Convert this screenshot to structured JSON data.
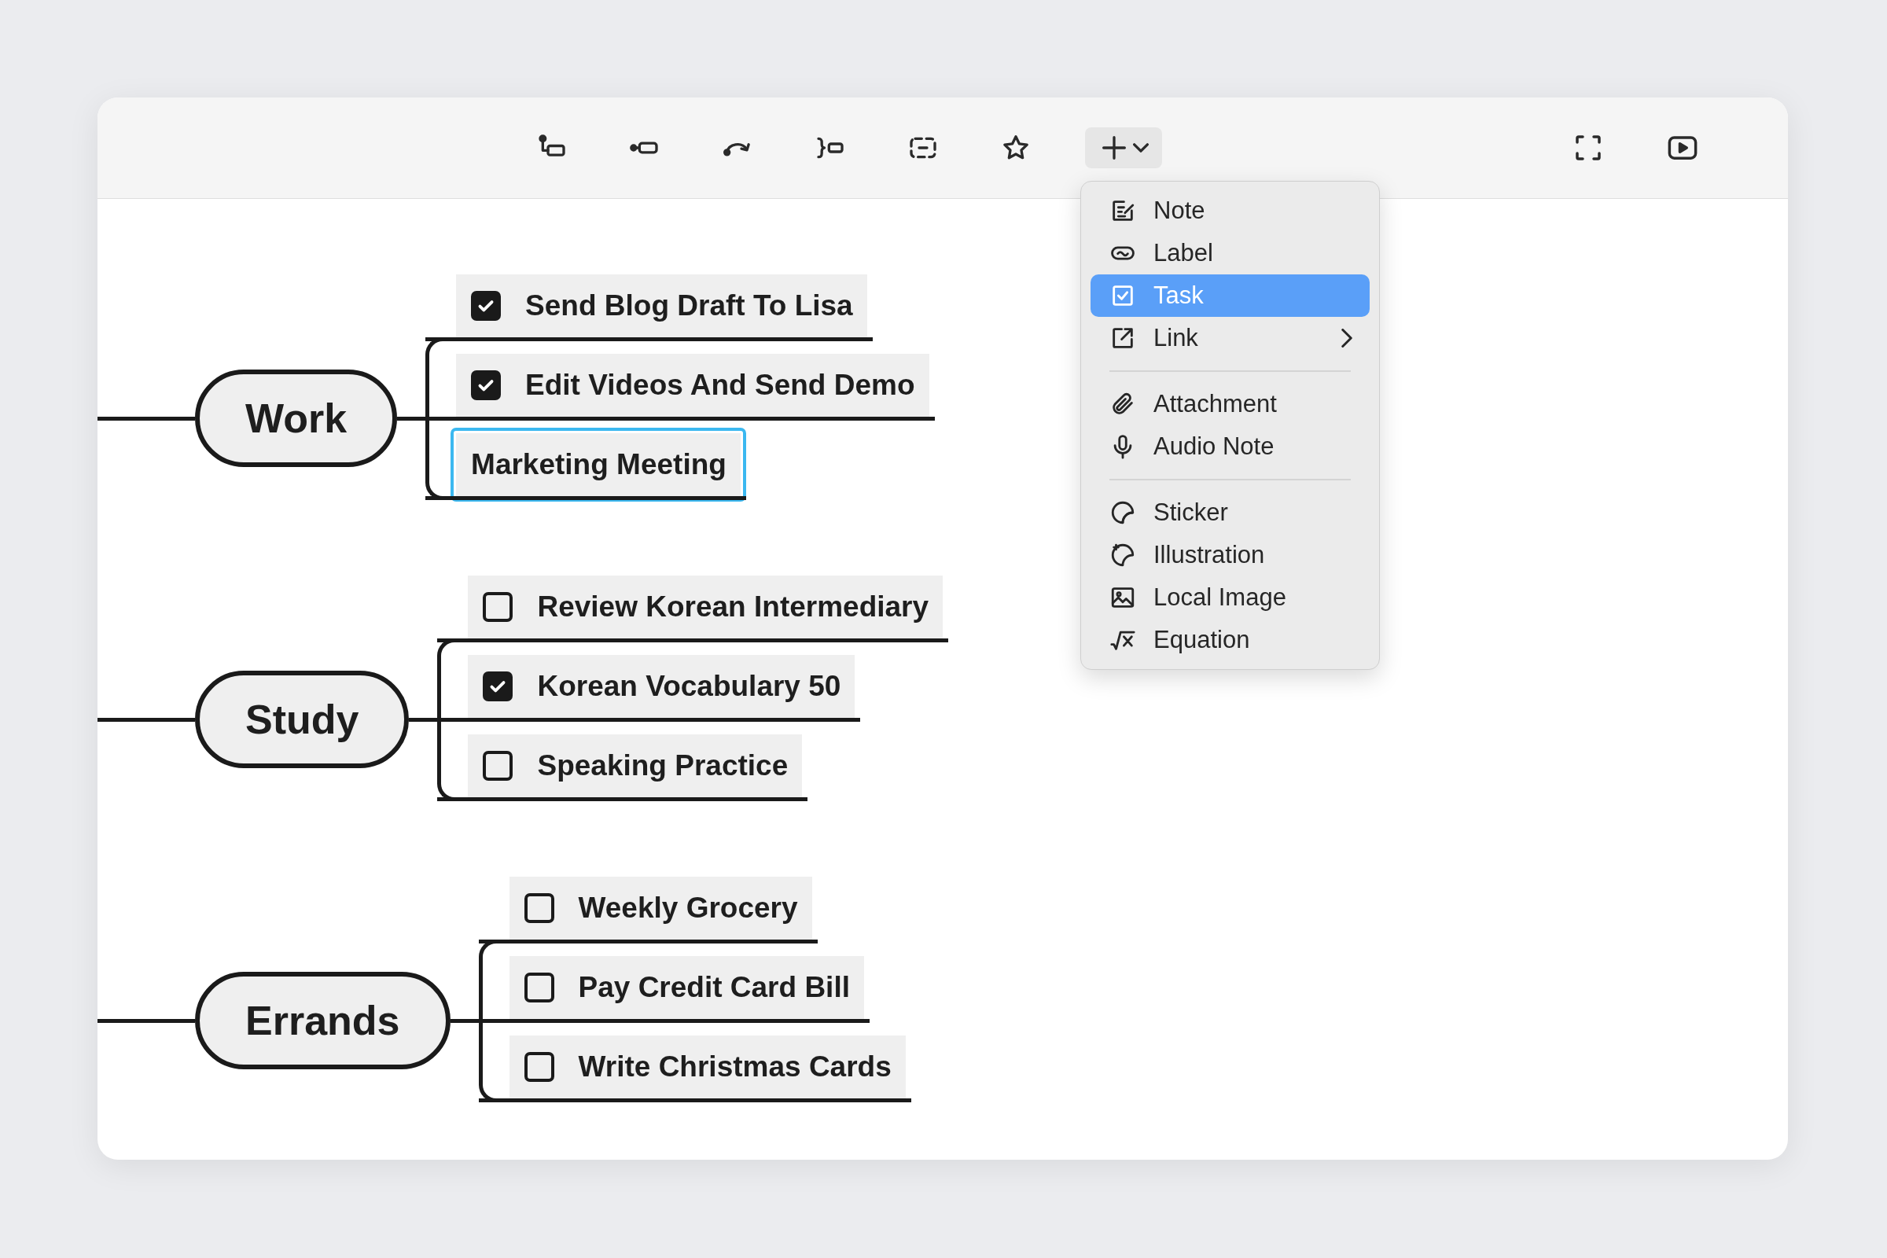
{
  "toolbar": {
    "insert_menu_open": true
  },
  "insert_menu": {
    "sections": [
      [
        {
          "label": "Note",
          "selected": false,
          "submenu": false
        },
        {
          "label": "Label",
          "selected": false,
          "submenu": false
        },
        {
          "label": "Task",
          "selected": true,
          "submenu": false
        },
        {
          "label": "Link",
          "selected": false,
          "submenu": true
        }
      ],
      [
        {
          "label": "Attachment",
          "selected": false,
          "submenu": false
        },
        {
          "label": "Audio Note",
          "selected": false,
          "submenu": false
        }
      ],
      [
        {
          "label": "Sticker",
          "selected": false,
          "submenu": false
        },
        {
          "label": "Illustration",
          "selected": false,
          "submenu": false
        },
        {
          "label": "Local Image",
          "selected": false,
          "submenu": false
        },
        {
          "label": "Equation",
          "selected": false,
          "submenu": false
        }
      ]
    ]
  },
  "mind_map": {
    "topics": [
      {
        "label": "Work",
        "children": [
          {
            "kind": "task",
            "label": "Send Blog Draft To Lisa",
            "checked": true,
            "selected": false
          },
          {
            "kind": "task",
            "label": "Edit Videos And Send Demo",
            "checked": true,
            "selected": false
          },
          {
            "kind": "topic",
            "label": "Marketing Meeting",
            "selected": true
          }
        ]
      },
      {
        "label": "Study",
        "children": [
          {
            "kind": "task",
            "label": "Review Korean Intermediary",
            "checked": false,
            "selected": false
          },
          {
            "kind": "task",
            "label": "Korean Vocabulary 50",
            "checked": true,
            "selected": false
          },
          {
            "kind": "task",
            "label": "Speaking Practice",
            "checked": false,
            "selected": false
          }
        ]
      },
      {
        "label": "Errands",
        "children": [
          {
            "kind": "task",
            "label": "Weekly Grocery",
            "checked": false,
            "selected": false
          },
          {
            "kind": "task",
            "label": "Pay Credit Card Bill",
            "checked": false,
            "selected": false
          },
          {
            "kind": "task",
            "label": "Write Christmas Cards",
            "checked": false,
            "selected": false
          }
        ]
      }
    ]
  }
}
